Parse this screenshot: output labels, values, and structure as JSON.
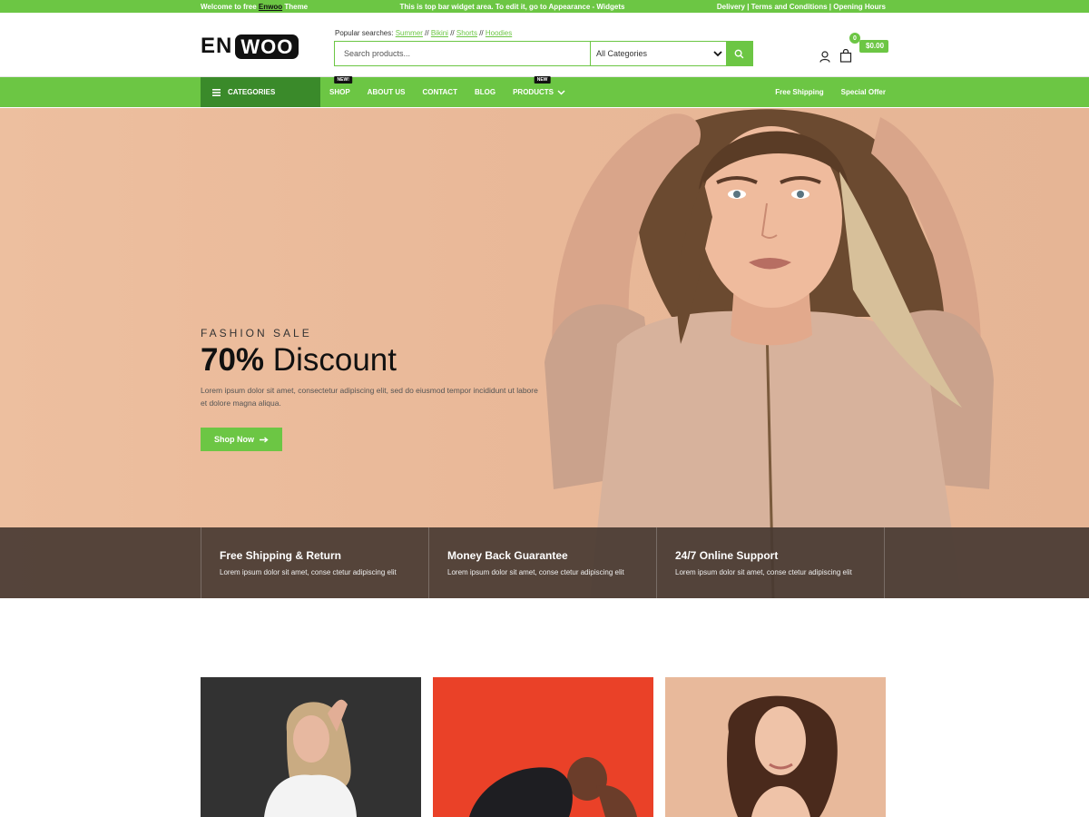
{
  "topbar": {
    "welcome_prefix": "Welcome to free",
    "welcome_link": "Enwoo",
    "welcome_suffix": "Theme",
    "center_text": "This is top bar widget area. To edit it, go to Appearance - Widgets",
    "links": [
      "Delivery",
      "Terms and Conditions",
      "Opening Hours"
    ]
  },
  "header": {
    "logo_en": "EN",
    "logo_woo": "WOO",
    "popular_label": "Popular searches:",
    "popular_terms": [
      "Summer",
      "Bikini",
      "Shorts",
      "Hoodies"
    ],
    "search_placeholder": "Search products...",
    "category_selected": "All Categories",
    "cart_count": "0",
    "cart_total": "$0.00"
  },
  "nav": {
    "categories_label": "CATEGORIES",
    "items": [
      {
        "label": "SHOP",
        "tag": "NEW!"
      },
      {
        "label": "ABOUT US",
        "tag": ""
      },
      {
        "label": "CONTACT",
        "tag": ""
      },
      {
        "label": "BLOG",
        "tag": ""
      },
      {
        "label": "PRODUCTS",
        "tag": "NEW"
      }
    ],
    "right_links": [
      "Free Shipping",
      "Special Offer"
    ]
  },
  "hero": {
    "eyebrow": "FASHION SALE",
    "headline_bold": "70%",
    "headline_rest": "Discount",
    "body": "Lorem ipsum dolor sit amet, consectetur adipiscing elit, sed do eiusmod tempor incididunt ut labore et dolore magna aliqua.",
    "cta": "Shop Now"
  },
  "features": [
    {
      "title": "Free Shipping & Return",
      "text": "Lorem ipsum dolor sit amet, conse ctetur adipiscing elit"
    },
    {
      "title": "Money Back Guarantee",
      "text": "Lorem ipsum dolor sit amet, conse ctetur adipiscing elit"
    },
    {
      "title": "24/7 Online Support",
      "text": "Lorem ipsum dolor sit amet, conse ctetur adipiscing elit"
    }
  ],
  "colors": {
    "accent": "#6cc644",
    "accent_dark": "#3a8a2a",
    "hero_bg": "#eab999"
  },
  "icons": [
    "search-icon",
    "user-icon",
    "cart-icon",
    "menu-icon",
    "chevron-down-icon",
    "arrow-right-icon"
  ]
}
